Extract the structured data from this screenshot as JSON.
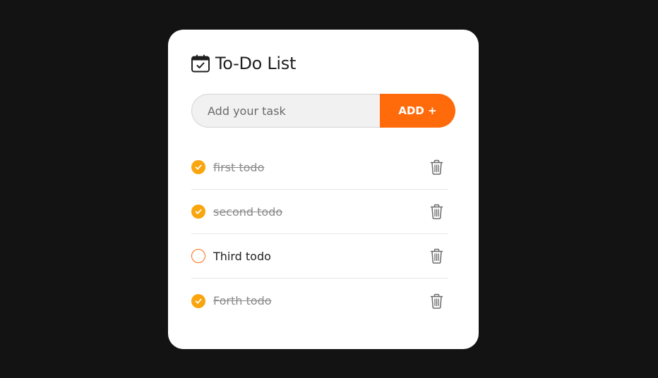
{
  "app": {
    "title": "To-Do List",
    "icon": "calendar-check-icon"
  },
  "input": {
    "value": "",
    "placeholder": "Add your task"
  },
  "add_button": {
    "label": "ADD +"
  },
  "todos": [
    {
      "label": "first todo",
      "completed": true
    },
    {
      "label": "second todo",
      "completed": true
    },
    {
      "label": "Third todo",
      "completed": false
    },
    {
      "label": "Forth todo",
      "completed": true
    }
  ],
  "colors": {
    "background": "#131313",
    "card": "#ffffff",
    "accent": "#ff6b0b",
    "checked": "#f9a50e",
    "done_text": "#8a8a8a"
  }
}
